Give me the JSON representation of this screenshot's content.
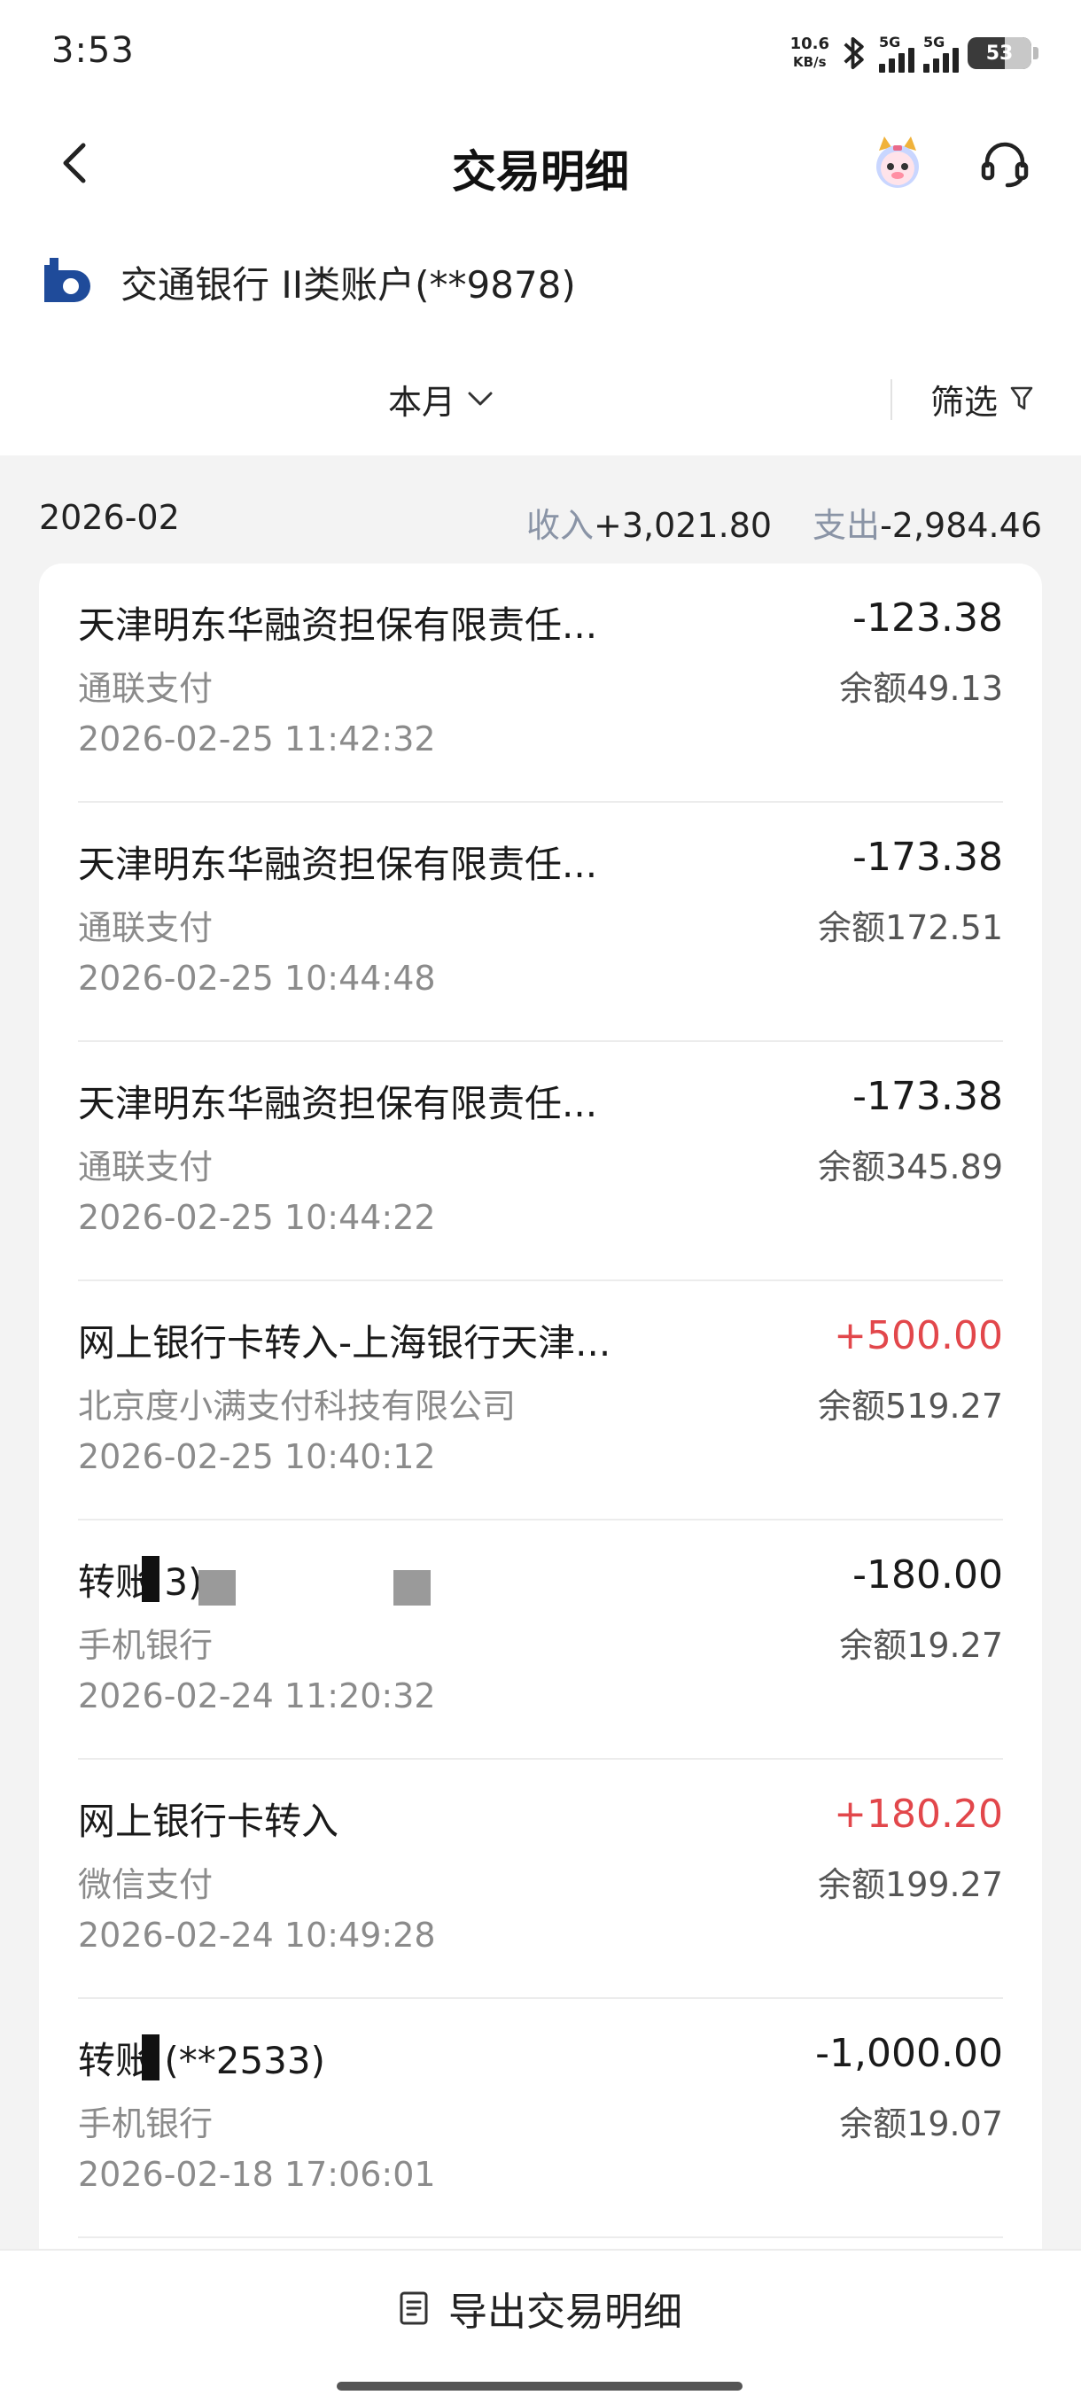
{
  "status": {
    "time": "3:53",
    "net_speed_value": "10.6",
    "net_speed_unit": "KB/s",
    "signal1_label": "5G",
    "signal2_label": "5G",
    "battery": "53"
  },
  "header": {
    "title": "交易明细"
  },
  "account": {
    "name": "交通银行 II类账户(**9878)"
  },
  "filter": {
    "period": "本月",
    "filter_label": "筛选"
  },
  "summary": {
    "month": "2026-02",
    "income_label": "收入",
    "income_value": "+3,021.80",
    "expense_label": "支出",
    "expense_value": "-2,984.46"
  },
  "transactions": [
    {
      "title": "天津明东华融资担保有限责任...",
      "amount": "-123.38",
      "type": "expense",
      "channel": "通联支付",
      "balance": "余额49.13",
      "time": "2026-02-25 11:42:32"
    },
    {
      "title": "天津明东华融资担保有限责任...",
      "amount": "-173.38",
      "type": "expense",
      "channel": "通联支付",
      "balance": "余额172.51",
      "time": "2026-02-25 10:44:48"
    },
    {
      "title": "天津明东华融资担保有限责任...",
      "amount": "-173.38",
      "type": "expense",
      "channel": "通联支付",
      "balance": "余额345.89",
      "time": "2026-02-25 10:44:22"
    },
    {
      "title": "网上银行卡转入-上海银行天津...",
      "amount": "+500.00",
      "type": "income",
      "channel": "北京度小满支付科技有限公司",
      "balance": "余额519.27",
      "time": "2026-02-25 10:40:12"
    },
    {
      "title": "转账                                      3)",
      "amount": "-180.00",
      "type": "expense",
      "channel": "手机银行",
      "balance": "余额19.27",
      "time": "2026-02-24 11:20:32"
    },
    {
      "title": "网上银行卡转入",
      "amount": "+180.20",
      "type": "income",
      "channel": "微信支付",
      "balance": "余额199.27",
      "time": "2026-02-24 10:49:28"
    },
    {
      "title": "转账         (**2533)",
      "amount": "-1,000.00",
      "type": "expense",
      "channel": "手机银行",
      "balance": "余额19.07",
      "time": "2026-02-18 17:06:01"
    }
  ],
  "footer": {
    "export_label": "导出交易明细"
  },
  "colors": {
    "income": "#e2474b",
    "muted": "#8b8b8b",
    "summary_label": "#8a94a6",
    "bank_blue": "#1f4b9a"
  }
}
